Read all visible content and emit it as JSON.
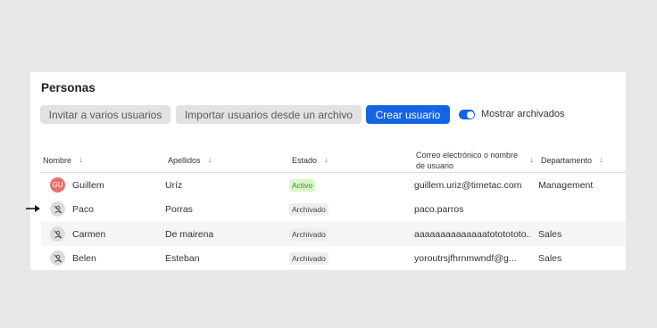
{
  "page_title": "Personas",
  "toolbar": {
    "invite_label": "Invitar a varios usuarios",
    "import_label": "Importar usuarios desde un archivo",
    "create_label": "Crear usuario",
    "toggle_label": "Mostrar archivados",
    "toggle_on": true
  },
  "columns": {
    "name": "Nombre",
    "surname": "Apellidos",
    "status": "Estado",
    "email_line1": "Correo electrónico o nombre",
    "email_line2": "de usuario",
    "department": "Departamento"
  },
  "rows": [
    {
      "initials": "GU",
      "name": "Guillem",
      "surname": "Uríz",
      "status": "Activo",
      "email": "guillem.uriz@timetac.com",
      "department": "Management"
    },
    {
      "initials": "",
      "name": "Paco",
      "surname": "Porras",
      "status": "Archivado",
      "email": "paco.parros",
      "department": ""
    },
    {
      "initials": "",
      "name": "Carmen",
      "surname": "De mairena",
      "status": "Archivado",
      "email": "aaaaaaaaaaaaaatototototo...",
      "department": "Sales"
    },
    {
      "initials": "",
      "name": "Belen",
      "surname": "Esteban",
      "status": "Archivado",
      "email": "yoroutrsjfhrnmwndf@g...",
      "department": "Sales"
    }
  ],
  "colors": {
    "accent": "#1464e6",
    "active_badge": "#d9f7c8",
    "avatar_red": "#e8706a"
  },
  "icons": {
    "sort": "arrow-down-icon",
    "archived_avatar": "user-off-icon",
    "pointer": "arrow-right-icon"
  }
}
